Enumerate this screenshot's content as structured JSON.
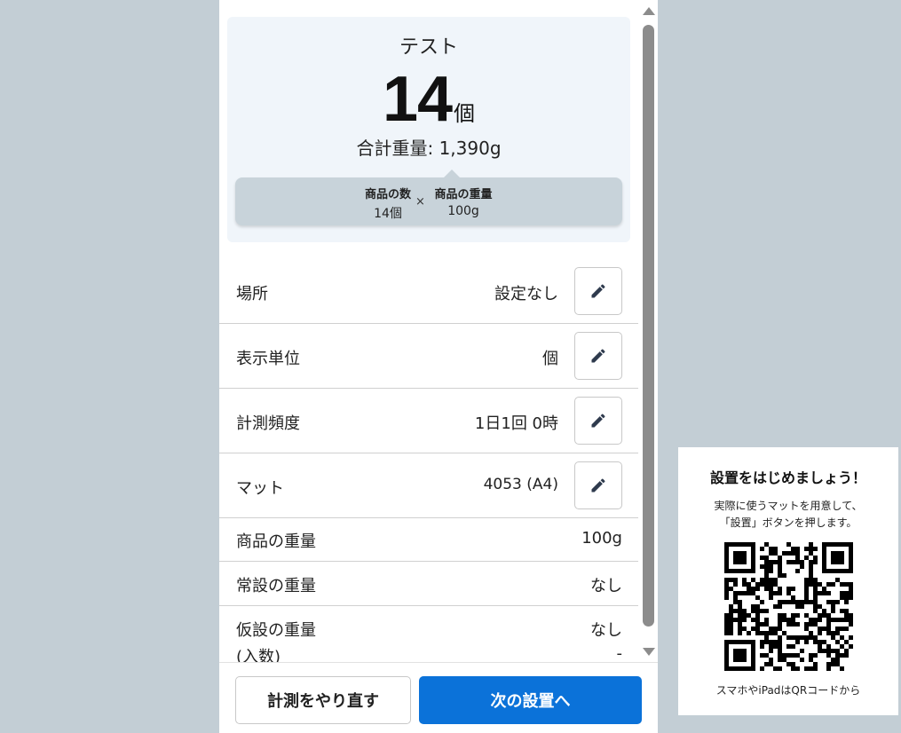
{
  "summary": {
    "item_name": "テスト",
    "count": "14",
    "count_unit": "個",
    "total_weight": "合計重量: 1,390g",
    "formula": {
      "count_label": "商品の数",
      "count_value": "14個",
      "times": "×",
      "weight_label": "商品の重量",
      "weight_value": "100g"
    }
  },
  "settings": [
    {
      "label": "場所",
      "value": "設定なし",
      "editable": true
    },
    {
      "label": "表示単位",
      "value": "個",
      "editable": true
    },
    {
      "label": "計測頻度",
      "value": "1日1回 0時",
      "editable": true
    },
    {
      "label": "マット",
      "value": "4053 (A4)",
      "editable": true
    }
  ],
  "details": [
    {
      "label": "商品の重量",
      "value": "100g"
    },
    {
      "label": "常設の重量",
      "value": "なし"
    },
    {
      "label": "仮設の重量",
      "label_sub": "(入数)",
      "value": "なし",
      "value_sub": "-"
    }
  ],
  "footer": {
    "retry_label": "計測をやり直す",
    "next_label": "次の設置へ"
  },
  "setup_card": {
    "title": "設置をはじめましょう！",
    "desc_line1": "実際に使うマットを用意して、",
    "desc_line2": "「設置」ボタンを押します。",
    "qr_caption": "スマホやiPadはQRコードから"
  },
  "icons": {
    "edit": "pencil-icon",
    "qr": "qr-code"
  },
  "colors": {
    "primary": "#0b72d9",
    "background": "#c3ced5",
    "summary_bg": "#f0f5fa",
    "formula_bg": "#c8d3da",
    "icon": "#2e3a4d"
  }
}
